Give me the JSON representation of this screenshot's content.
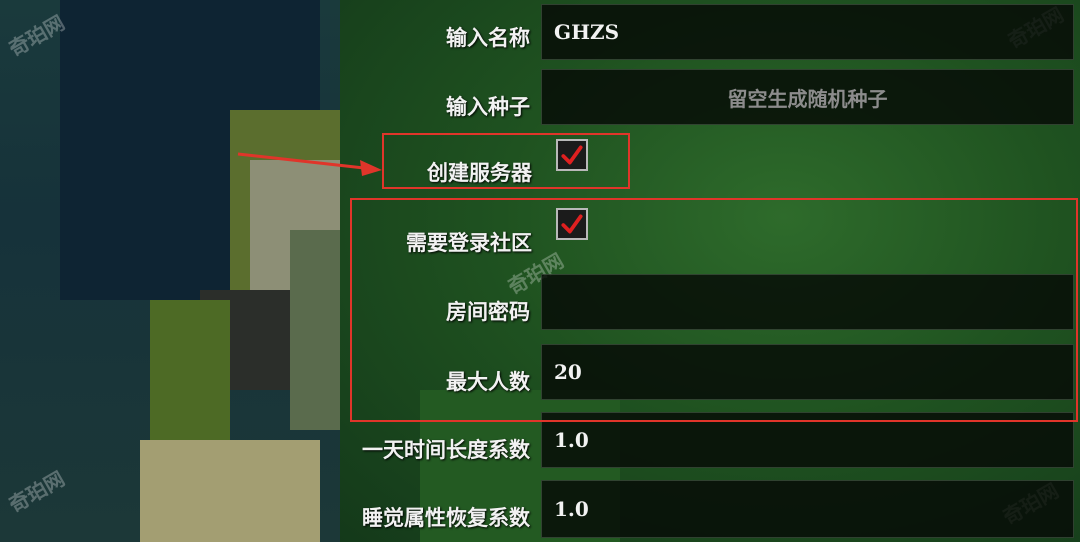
{
  "form": {
    "name_label": "输入名称",
    "name_value": "GHZS",
    "seed_label": "输入种子",
    "seed_placeholder": "留空生成随机种子",
    "server_label": "创建服务器",
    "server_checked": true,
    "community_label": "需要登录社区",
    "community_checked": true,
    "password_label": "房间密码",
    "password_value": "",
    "maxplayers_label": "最大人数",
    "maxplayers_value": "20",
    "daylength_label": "一天时间长度系数",
    "daylength_value": "1.0",
    "sleep_label": "睡觉属性恢复系数",
    "sleep_value": "1.0"
  },
  "watermark": "奇珀网",
  "colors": {
    "annotation_red": "#e0352a",
    "check_red": "#e02020"
  }
}
